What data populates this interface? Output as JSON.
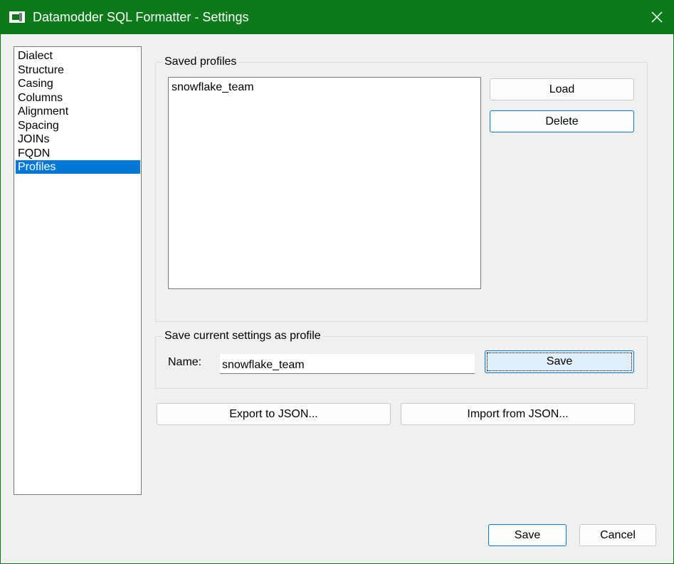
{
  "window": {
    "title": "Datamodder SQL Formatter - Settings",
    "accent_color": "#0c7a1a",
    "app_icon": "app-window-icon",
    "close_icon": "close-icon"
  },
  "nav": {
    "items": [
      {
        "label": "Dialect",
        "selected": false
      },
      {
        "label": "Structure",
        "selected": false
      },
      {
        "label": "Casing",
        "selected": false
      },
      {
        "label": "Columns",
        "selected": false
      },
      {
        "label": "Alignment",
        "selected": false
      },
      {
        "label": "Spacing",
        "selected": false
      },
      {
        "label": "JOINs",
        "selected": false
      },
      {
        "label": "FQDN",
        "selected": false
      },
      {
        "label": "Profiles",
        "selected": true
      }
    ],
    "selected_color": "#0078d7"
  },
  "saved_profiles": {
    "group_title": "Saved profiles",
    "items": [
      "snowflake_team"
    ],
    "load_label": "Load",
    "delete_label": "Delete"
  },
  "save_profile": {
    "group_title": "Save current settings as profile",
    "name_label": "Name:",
    "name_value": "snowflake_team",
    "save_label": "Save"
  },
  "json": {
    "export_label": "Export to JSON...",
    "import_label": "Import from JSON..."
  },
  "footer": {
    "save_label": "Save",
    "cancel_label": "Cancel"
  }
}
